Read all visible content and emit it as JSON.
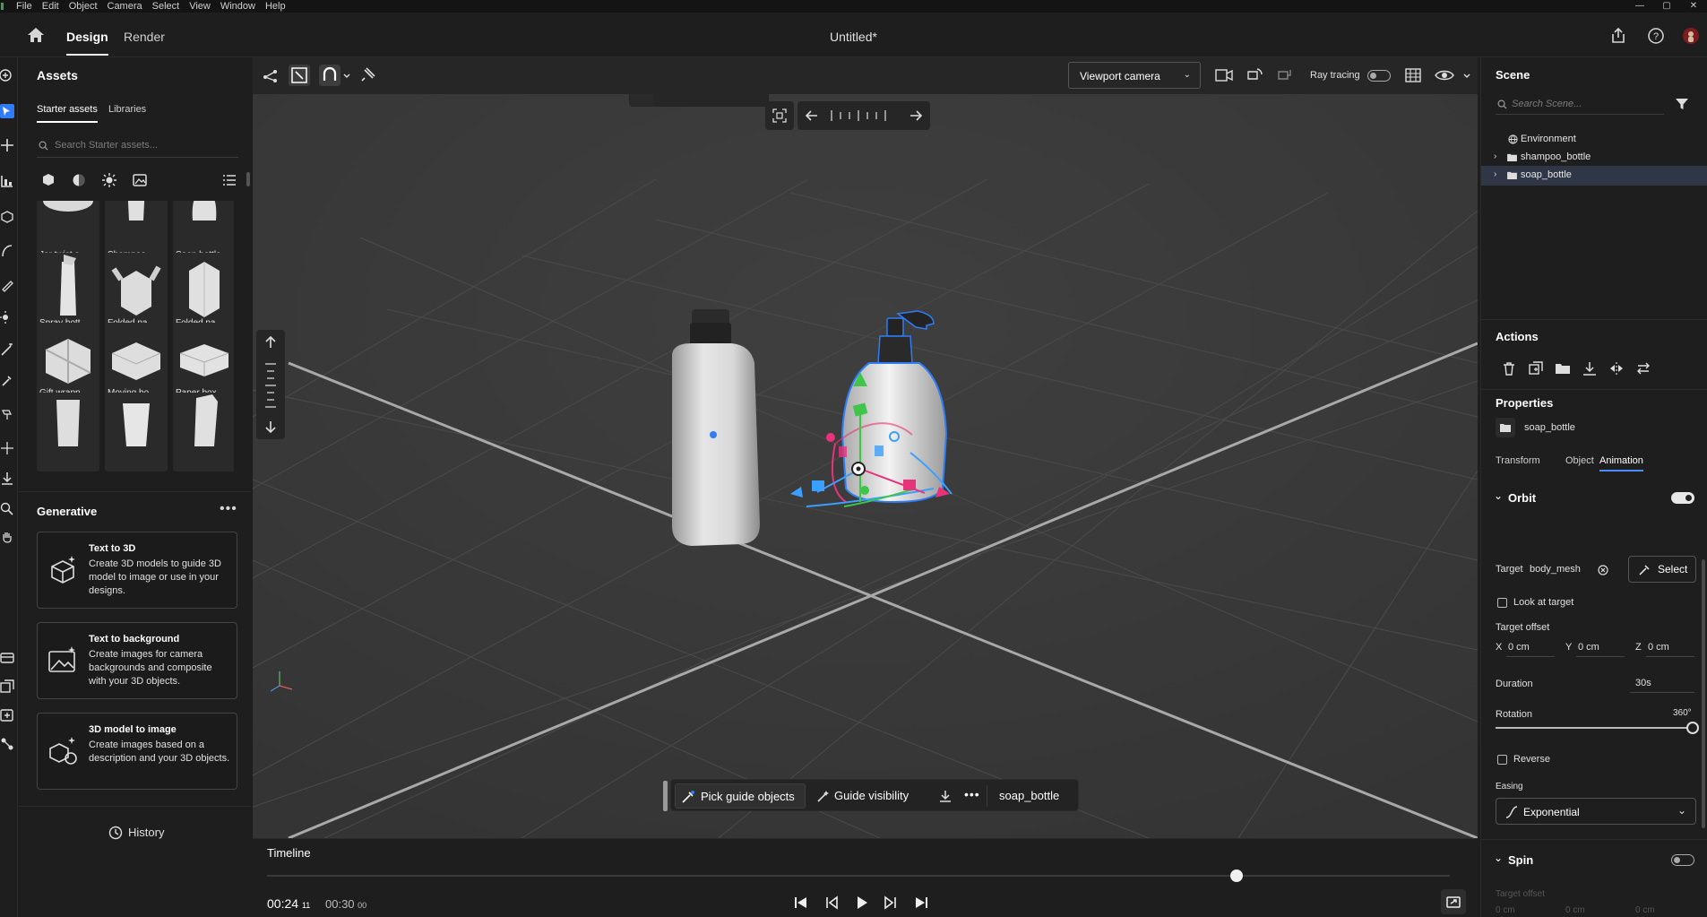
{
  "menubar": {
    "items": [
      "File",
      "Edit",
      "Object",
      "Camera",
      "Select",
      "View",
      "Window",
      "Help"
    ],
    "window_controls": [
      "—",
      "▢",
      "✕"
    ]
  },
  "topbar": {
    "tabs": [
      "Design",
      "Render"
    ],
    "document_title": "Untitled*"
  },
  "assets": {
    "title": "Assets",
    "tabs": [
      "Starter assets",
      "Libraries"
    ],
    "search_placeholder": "Search Starter assets...",
    "items": [
      "Jar twist s...",
      "Shampoo ...",
      "Soap bottle",
      "Spray bott...",
      "Folded pa...",
      "Folded pa...",
      "Gift wrapp...",
      "Moving bo...",
      "Paper box ...",
      "",
      "",
      ""
    ]
  },
  "generative": {
    "title": "Generative",
    "more": "•••",
    "cards": [
      {
        "title": "Text to 3D",
        "desc": "Create 3D models to guide 3D model to image or use in your designs."
      },
      {
        "title": "Text to background",
        "desc": "Create images for camera backgrounds and composite with your 3D objects."
      },
      {
        "title": "3D model to image",
        "desc": "Create images based on a description and your 3D objects."
      }
    ],
    "history_label": "History"
  },
  "viewport": {
    "camera": "Viewport camera",
    "ray_tracing_label": "Ray tracing",
    "ray_tracing_on": false,
    "bottom_bar": {
      "pick_guide": "Pick guide objects",
      "guide_visibility": "Guide visibility",
      "more": "•••",
      "selected": "soap_bottle"
    }
  },
  "timeline": {
    "title": "Timeline",
    "current_time": "00:24",
    "current_frame": "11",
    "total_time": "00:30",
    "total_frame": "00",
    "playhead_fraction": 0.82
  },
  "scene": {
    "title": "Scene",
    "search_placeholder": "Search Scene...",
    "tree": [
      {
        "label": "Environment",
        "type": "environment",
        "expandable": false,
        "selected": false
      },
      {
        "label": "shampoo_bottle",
        "type": "folder",
        "expandable": true,
        "selected": false
      },
      {
        "label": "soap_bottle",
        "type": "folder",
        "expandable": true,
        "selected": true
      }
    ]
  },
  "actions": {
    "title": "Actions"
  },
  "properties": {
    "title": "Properties",
    "object_name": "soap_bottle",
    "tabs": [
      "Transform",
      "Object",
      "Animation"
    ],
    "active_tab": "Animation",
    "orbit": {
      "title": "Orbit",
      "enabled": true,
      "target_label": "Target",
      "target_value": "body_mesh",
      "select_label": "Select",
      "look_at_target": "Look at target",
      "target_offset_label": "Target offset",
      "offset": [
        {
          "axis": "X",
          "value": "0 cm"
        },
        {
          "axis": "Y",
          "value": "0 cm"
        },
        {
          "axis": "Z",
          "value": "0 cm"
        }
      ],
      "duration_label": "Duration",
      "duration_value": "30s",
      "rotation_label": "Rotation",
      "rotation_value": "360°",
      "rotation_fraction": 1.0,
      "reverse_label": "Reverse",
      "easing_label": "Easing",
      "easing_value": "Exponential"
    },
    "spin": {
      "title": "Spin",
      "enabled": false,
      "target_offset_label": "Target offset",
      "offset_values": [
        "0 cm",
        "0 cm",
        "0 cm"
      ]
    }
  },
  "colors": {
    "accent": "#4a8cff",
    "gizmo_red": "#e8337a",
    "gizmo_green": "#41c44a",
    "gizmo_blue": "#3aa0ff",
    "selection_outline": "#2e7cf6"
  }
}
